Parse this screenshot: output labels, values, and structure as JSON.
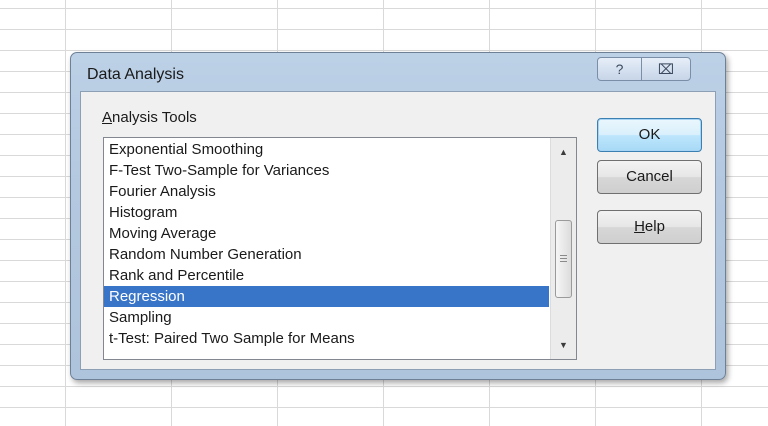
{
  "dialog": {
    "title": "Data Analysis",
    "help_caption": "?",
    "close_caption": "⌧"
  },
  "analysis_tools": {
    "label_underlined": "A",
    "label_rest": "nalysis Tools",
    "items": [
      "Exponential Smoothing",
      "F-Test Two-Sample for Variances",
      "Fourier Analysis",
      "Histogram",
      "Moving Average",
      "Random Number Generation",
      "Rank and Percentile",
      "Regression",
      "Sampling",
      "t-Test: Paired Two Sample for Means"
    ],
    "selected": "Regression"
  },
  "buttons": {
    "ok": "OK",
    "cancel": "Cancel",
    "help_underlined": "H",
    "help_rest": "elp"
  },
  "scrollbar": {
    "up_arrow": "▲",
    "down_arrow": "▼"
  },
  "colors": {
    "selection": "#3875c9",
    "dialog_frame": "#b4c9e0"
  }
}
